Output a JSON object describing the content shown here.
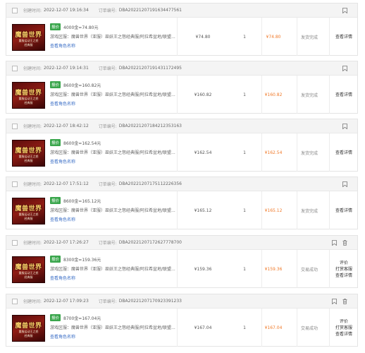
{
  "labels": {
    "created_label": "创建时间:",
    "order_no_label": "订单编号:",
    "tag": "报价",
    "view_role": "查看角色名称",
    "status_shipped": "发货完成",
    "status_success": "交易成功",
    "view_details": "查看详情",
    "rate": "评价",
    "buy_again": "打赏客服"
  },
  "thumbnail": {
    "title": "魔兽世界",
    "subtitle": "重服运动王之怒",
    "subtitle2": "经典服"
  },
  "colors": {
    "tag_bg": "#3aa64c",
    "paid_amount": "#f07a2a",
    "link": "#3a6ec6"
  },
  "orders": [
    {
      "created_time": "2022-12-07 19:16:34",
      "order_no": "DBA20221207191634477561",
      "title": "4000金=74.80元",
      "server": "游戏区服：魔兽世界（亚服）巫妖王之怒经典服/阿拉希盆地/联盟...",
      "price": "¥74.80",
      "qty": "1",
      "paid": "¥74.80",
      "status": "发货完成",
      "actions": [
        "查看详情"
      ],
      "has_trash": false
    },
    {
      "created_time": "2022-12-07 19:14:31",
      "order_no": "DBA20221207191431172495",
      "title": "8600金=160.82元",
      "server": "游戏区服：魔兽世界（亚服）巫妖王之怒经典服/阿拉希盆地/联盟...",
      "price": "¥160.82",
      "qty": "1",
      "paid": "¥160.82",
      "status": "发货完成",
      "actions": [
        "查看详情"
      ],
      "has_trash": false
    },
    {
      "created_time": "2022-12-07 18:42:12",
      "order_no": "DBA20221207184212353163",
      "title": "8600金=162.54元",
      "server": "游戏区服：魔兽世界（亚服）巫妖王之怒经典服/阿拉希盆地/联盟...",
      "price": "¥162.54",
      "qty": "1",
      "paid": "¥162.54",
      "status": "发货完成",
      "actions": [
        "查看详情"
      ],
      "has_trash": false
    },
    {
      "created_time": "2022-12-07 17:51:12",
      "order_no": "DBA20221207175112226356",
      "title": "8600金=165.12元",
      "server": "游戏区服：魔兽世界（亚服）巫妖王之怒经典服/阿拉希盆地/联盟...",
      "price": "¥165.12",
      "qty": "1",
      "paid": "¥165.12",
      "status": "发货完成",
      "actions": [
        "查看详情"
      ],
      "has_trash": false
    },
    {
      "created_time": "2022-12-07 17:26:27",
      "order_no": "DBA20221207172627778700",
      "title": "8300金=159.36元",
      "server": "游戏区服：魔兽世界（亚服）巫妖王之怒经典服/阿拉希盆地/联盟...",
      "price": "¥159.36",
      "qty": "1",
      "paid": "¥159.36",
      "status": "交易成功",
      "actions": [
        "评价",
        "打赏客服",
        "查看详情"
      ],
      "has_trash": true
    },
    {
      "created_time": "2022-12-07 17:09:23",
      "order_no": "DBA20221207170923391233",
      "title": "8700金=167.04元",
      "server": "游戏区服：魔兽世界（亚服）巫妖王之怒经典服/阿拉希盆地/联盟...",
      "price": "¥167.04",
      "qty": "1",
      "paid": "¥167.04",
      "status": "交易成功",
      "actions": [
        "评价",
        "打赏客服",
        "查看详情"
      ],
      "has_trash": true
    }
  ]
}
